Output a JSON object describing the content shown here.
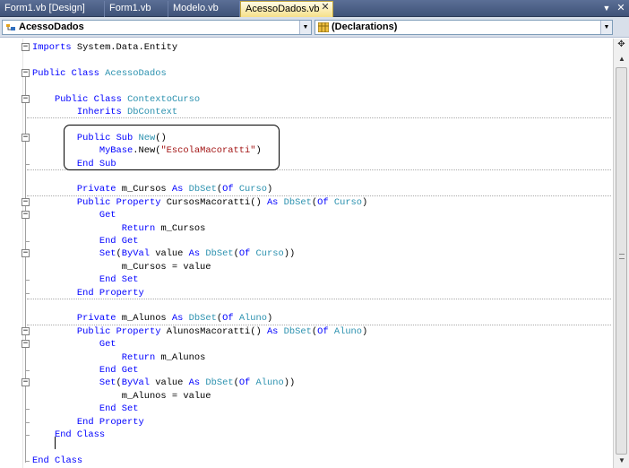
{
  "tabs": [
    {
      "label": "Form1.vb [Design]",
      "active": false
    },
    {
      "label": "Form1.vb",
      "active": false
    },
    {
      "label": "Modelo.vb",
      "active": false
    },
    {
      "label": "AcessoDados.vb",
      "active": true
    }
  ],
  "tab_close_glyph": "✕",
  "tab_overflow_glyph": "▼",
  "window_close_glyph": "✕",
  "navbar": {
    "class_combo": {
      "value": "AcessoDados",
      "icon": "vb-class-icon"
    },
    "member_combo": {
      "value": "(Declarations)",
      "icon": "declarations-icon"
    }
  },
  "code_lines": [
    [
      "Imports System.Data.Entity"
    ],
    [
      ""
    ],
    [
      "Public Class AcessoDados"
    ],
    [
      ""
    ],
    [
      "    Public Class ContextoCurso"
    ],
    [
      "        Inherits DbContext"
    ],
    [
      ""
    ],
    [
      "        Public Sub New()"
    ],
    [
      "            MyBase.New(\"EscolaMacoratti\")"
    ],
    [
      "        End Sub"
    ],
    [
      ""
    ],
    [
      "        Private m_Cursos As DbSet(Of Curso)"
    ],
    [
      "        Public Property CursosMacoratti() As DbSet(Of Curso)"
    ],
    [
      "            Get"
    ],
    [
      "                Return m_Cursos"
    ],
    [
      "            End Get"
    ],
    [
      "            Set(ByVal value As DbSet(Of Curso))"
    ],
    [
      "                m_Cursos = value"
    ],
    [
      "            End Set"
    ],
    [
      "        End Property"
    ],
    [
      ""
    ],
    [
      "        Private m_Alunos As DbSet(Of Aluno)"
    ],
    [
      "        Public Property AlunosMacoratti() As DbSet(Of Aluno)"
    ],
    [
      "            Get"
    ],
    [
      "                Return m_Alunos"
    ],
    [
      "            End Get"
    ],
    [
      "            Set(ByVal value As DbSet(Of Aluno))"
    ],
    [
      "                m_Alunos = value"
    ],
    [
      "            End Set"
    ],
    [
      "        End Property"
    ],
    [
      "    End Class"
    ],
    [
      ""
    ],
    [
      "End Class"
    ]
  ],
  "colors": {
    "keyword": "#0000ff",
    "type": "#2b91af",
    "string": "#a31515",
    "plain": "#000000",
    "active_tab": "#f6e08a",
    "tab_strip": "#4a5d85"
  }
}
